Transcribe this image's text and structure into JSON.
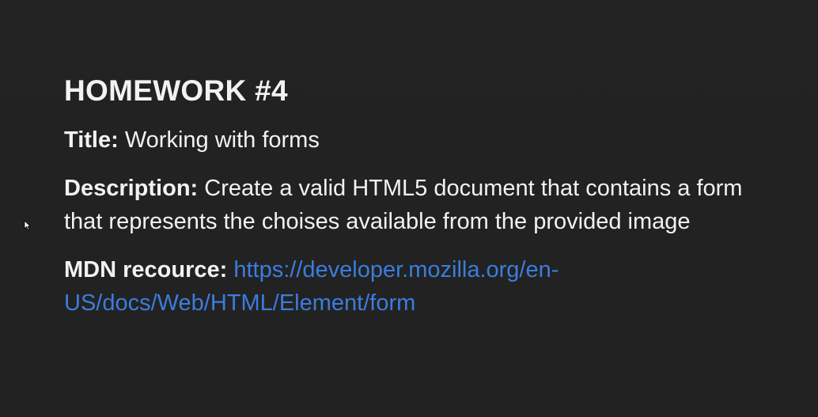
{
  "slide": {
    "heading": "HOMEWORK #4",
    "title_label": "Title:",
    "title_value": "Working with forms",
    "description_label": "Description:",
    "description_value": "Create a valid HTML5 document that contains a form that represents the choises available from the provided image",
    "resource_label": "MDN recource:",
    "resource_link": "https://developer.mozilla.org/en-US/docs/Web/HTML/Element/form"
  },
  "colors": {
    "background": "#222222",
    "text": "#f2f2f2",
    "link": "#3b7ddd"
  },
  "icons": {
    "cursor": "mouse-pointer-icon"
  }
}
